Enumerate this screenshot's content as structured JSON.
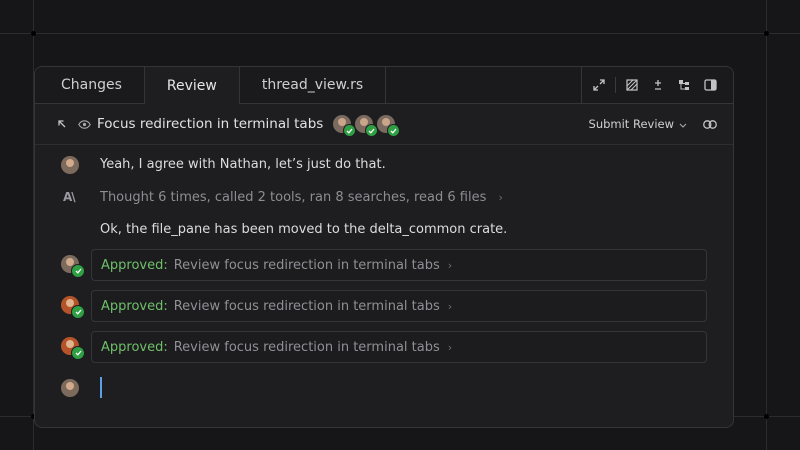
{
  "tabs": [
    {
      "label": "Changes"
    },
    {
      "label": "Review"
    },
    {
      "label": "thread_view.rs"
    }
  ],
  "active_tab": "Review",
  "header": {
    "title": "Focus redirection in terminal tabs",
    "submit_label": "Submit Review",
    "reviewer_count": 3
  },
  "messages": {
    "user_msg": "Yeah, I agree with Nathan, let’s just do that.",
    "thought": "Thought 6 times, called 2 tools, ran 8 searches, read 6 files",
    "assistant_msg": "Ok, the file_pane has been moved to the delta_common crate.",
    "assistant_logo": "A\\"
  },
  "approvals": [
    {
      "status": "Approved:",
      "text": "Review focus redirection in terminal tabs"
    },
    {
      "status": "Approved:",
      "text": "Review focus redirection in terminal tabs"
    },
    {
      "status": "Approved:",
      "text": "Review focus redirection in terminal tabs"
    }
  ],
  "colors": {
    "approved": "#6fbf6a",
    "check_badge": "#2ea043",
    "cursor": "#5aa0e8"
  },
  "icons": [
    "collapse-arrow-icon",
    "eye-icon",
    "expand-icon",
    "diff-icon",
    "plus-minus-icon",
    "tree-icon",
    "split-panel-icon",
    "chevron-down-icon",
    "link-icon",
    "chevron-right-icon"
  ]
}
